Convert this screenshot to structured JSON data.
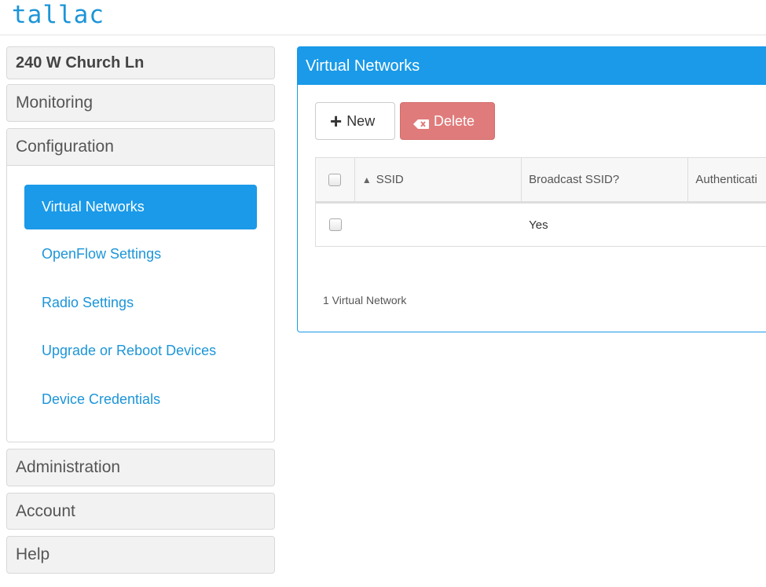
{
  "app": {
    "logo": "tallac"
  },
  "sidebar": {
    "site": "240 W Church Ln",
    "monitoring": "Monitoring",
    "configuration": {
      "label": "Configuration",
      "items": [
        {
          "label": "Virtual Networks",
          "active": true
        },
        {
          "label": "OpenFlow Settings",
          "active": false
        },
        {
          "label": "Radio Settings",
          "active": false
        },
        {
          "label": "Upgrade or Reboot Devices",
          "active": false
        },
        {
          "label": "Device Credentials",
          "active": false
        }
      ]
    },
    "administration": "Administration",
    "account": "Account",
    "help": "Help"
  },
  "main": {
    "title": "Virtual Networks",
    "new_label": "New",
    "delete_label": "Delete",
    "table": {
      "sort_indicator": "▲",
      "headers": [
        "SSID",
        "Broadcast SSID?",
        "Authenticati"
      ],
      "rows": [
        {
          "ssid": "",
          "broadcast": "Yes",
          "auth": ""
        }
      ]
    },
    "count_label": "1 Virtual Network"
  },
  "colors": {
    "accent": "#1a9ae8",
    "link": "#1c95d8",
    "danger": "#e07b7b"
  }
}
